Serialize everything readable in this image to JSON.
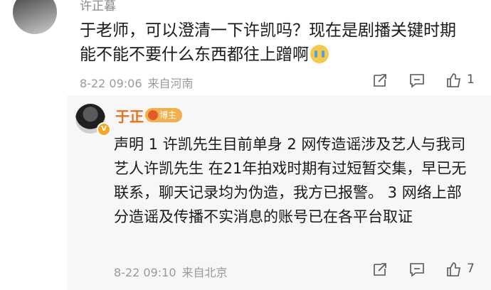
{
  "comment": {
    "username": "许正暮",
    "text": "于老师，可以澄清一下许凯吗？现在是剧播关键时期能不能不要什么东西都往上蹭啊",
    "emoji": "cry-icon",
    "date": "8-22 09:06",
    "source": "来自河南",
    "likes": "1"
  },
  "reply": {
    "username": "于正",
    "badge": "博主",
    "text": "声明 1 许凯先生目前单身 2 网传造谣涉及艺人与我司艺人许凯先生 在21年拍戏时期有过短暂交集，早已无联系，聊天记录均为伪造，我方已报警。 3 网络上部分造谣及传播不实消息的账号已在各平台取证",
    "date": "8-22 09:10",
    "source": "来自北京",
    "likes": "7"
  },
  "icons": {
    "share": "share-icon",
    "comment": "comment-icon",
    "like": "like-icon"
  },
  "colors": {
    "username_orange": "#e8701a",
    "badge_bg": "#f3b04a"
  }
}
